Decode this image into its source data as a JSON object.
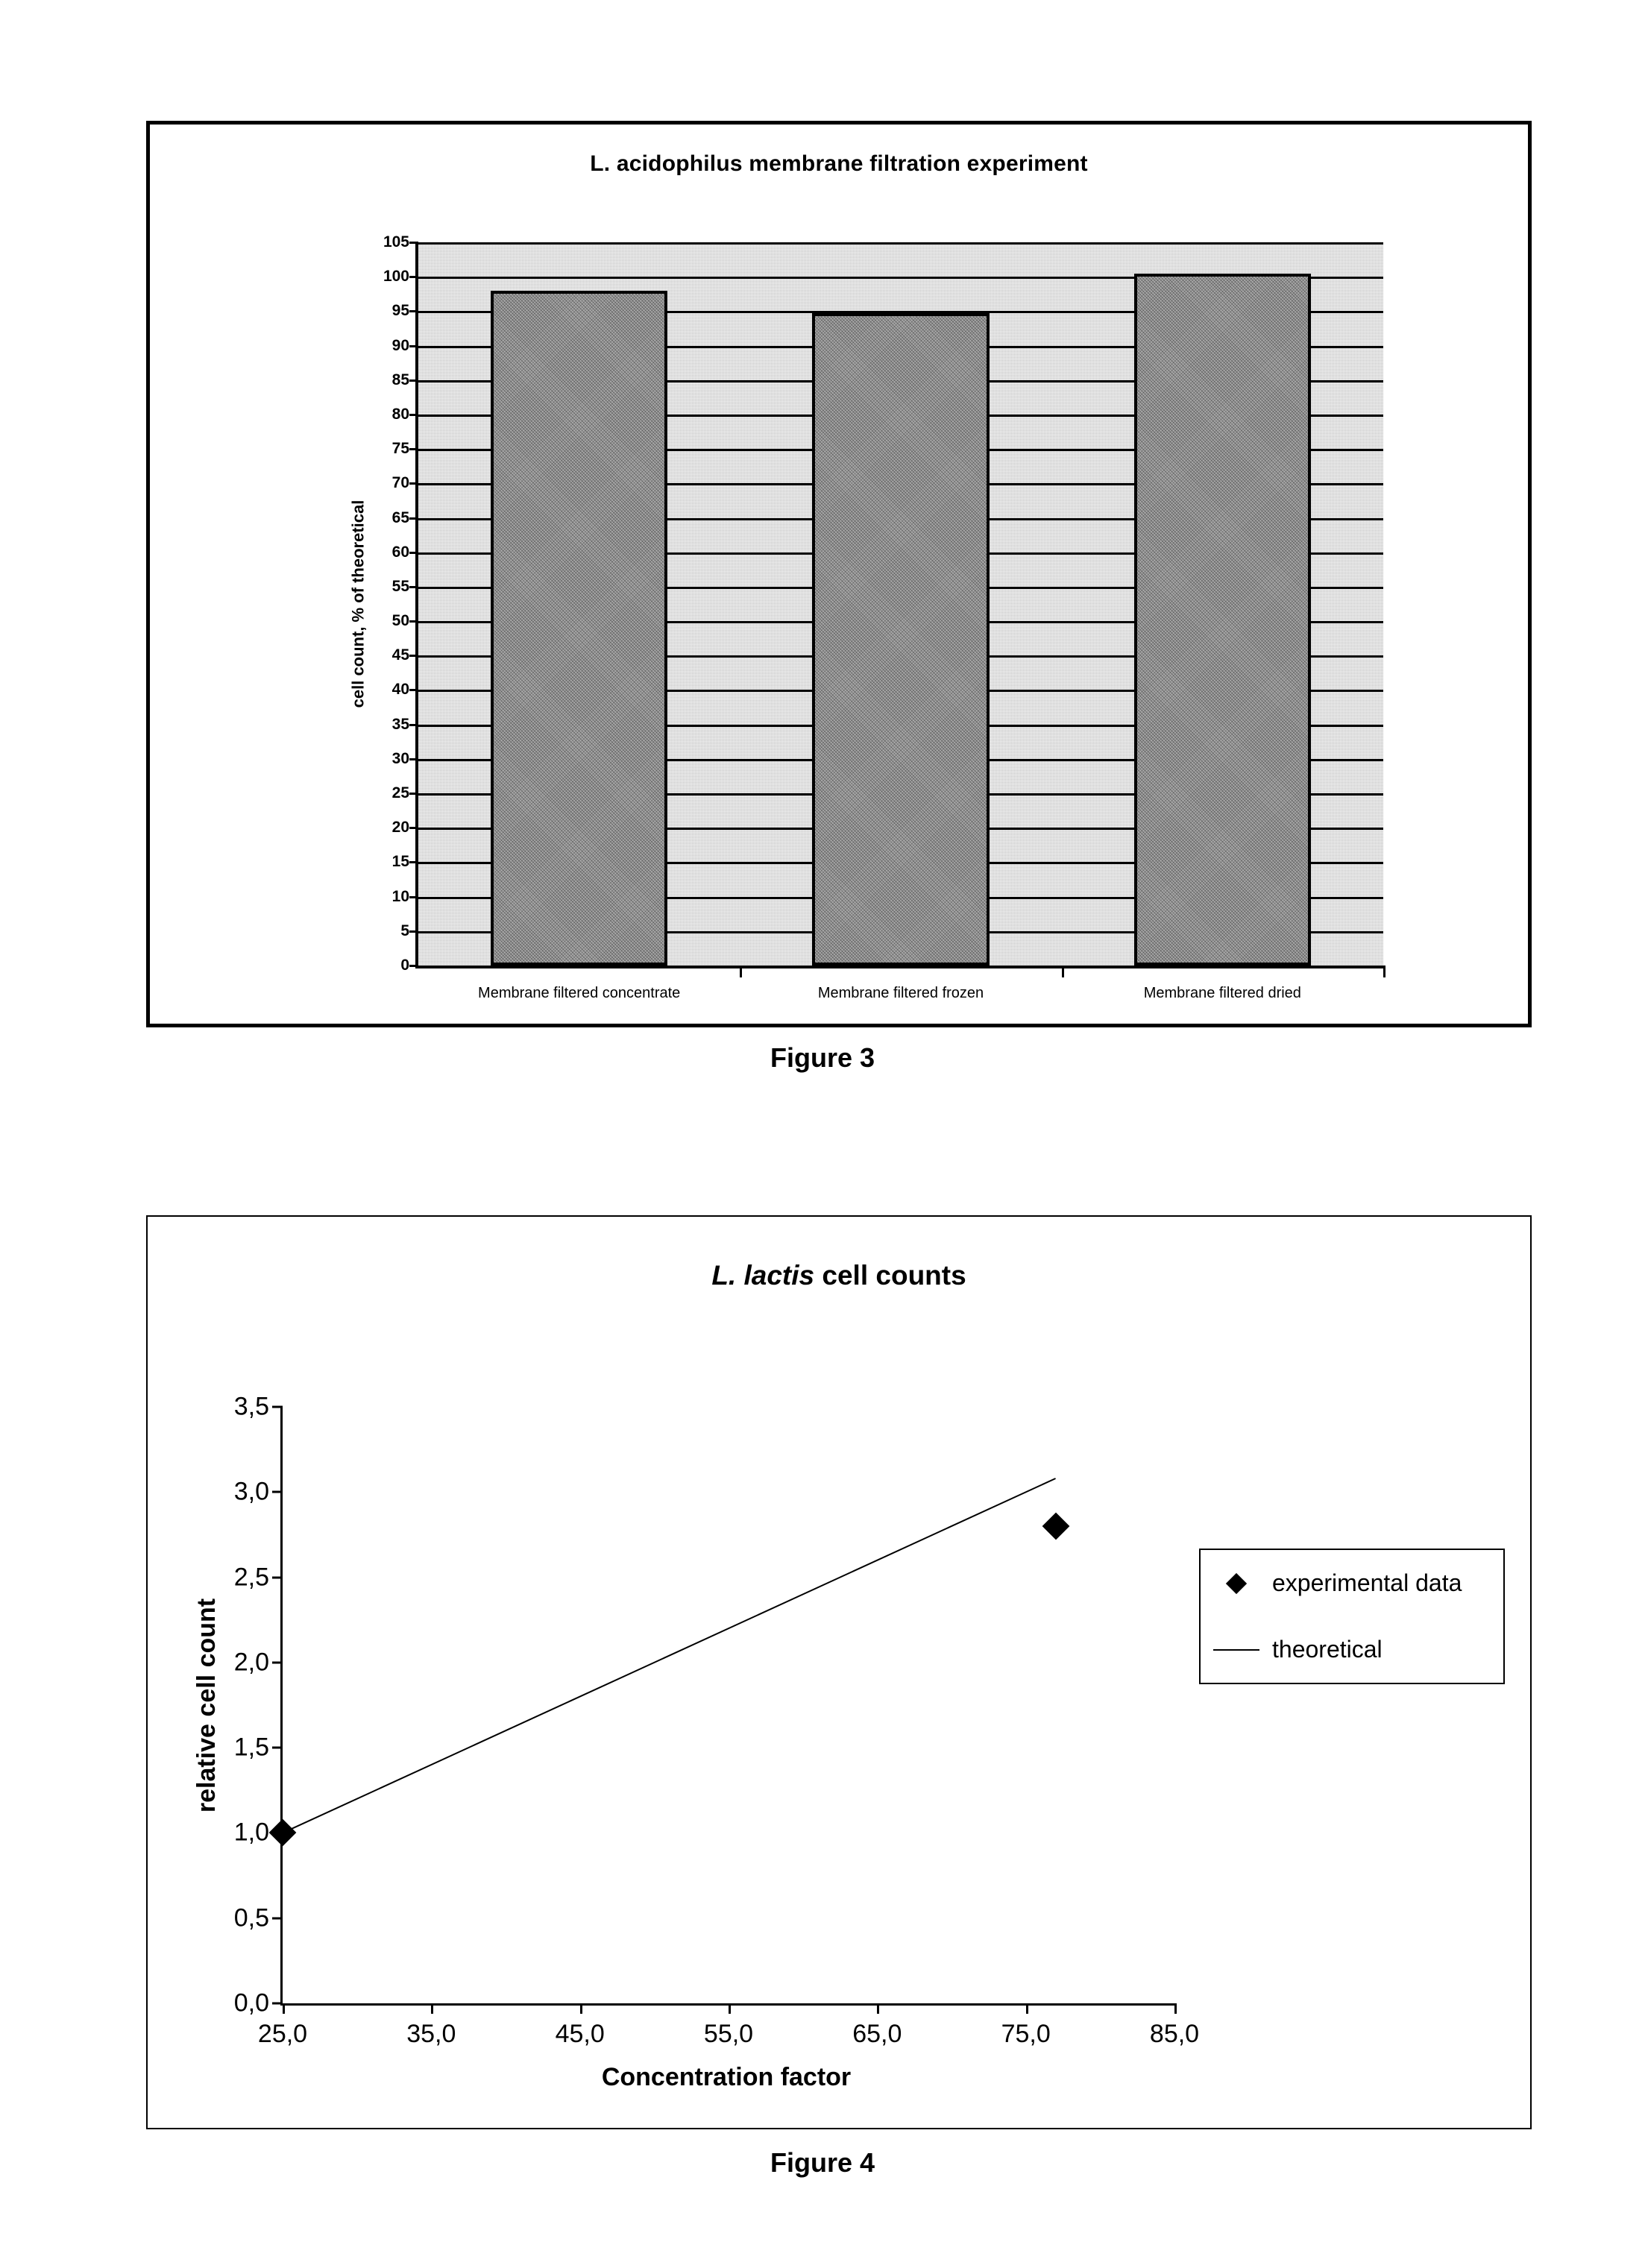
{
  "figures": [
    {
      "caption": "Figure 3",
      "chart_data": {
        "type": "bar",
        "title": "L. acidophilus membrane filtration experiment",
        "xlabel": "",
        "ylabel": "cell count, % of theoretical",
        "categories": [
          "Membrane filtered concentrate",
          "Membrane filtered frozen",
          "Membrane filtered dried"
        ],
        "values": [
          98,
          94.7,
          100.5
        ],
        "ylim": [
          0,
          105
        ],
        "ytick_step": 5,
        "yticks": [
          0,
          5,
          10,
          15,
          20,
          25,
          30,
          35,
          40,
          45,
          50,
          55,
          60,
          65,
          70,
          75,
          80,
          85,
          90,
          95,
          100,
          105
        ],
        "ytick_labels": [
          "0",
          "5",
          "10",
          "15",
          "20",
          "25",
          "30",
          "35",
          "40",
          "45",
          "50",
          "55",
          "60",
          "65",
          "70",
          "75",
          "80",
          "85",
          "90",
          "95",
          "100",
          "105"
        ],
        "grid": true,
        "legend": false,
        "plot_background": "#c8c8c8",
        "bar_fill": "#a8a8a8",
        "bar_edge": "#000000"
      }
    },
    {
      "caption": "Figure 4",
      "chart_data": {
        "type": "scatter",
        "title_species": "L. lactis",
        "title_rest": " cell counts",
        "title": "L. lactis cell counts",
        "xlabel": "Concentration factor",
        "ylabel": "relative cell count",
        "xlim": [
          25.0,
          85.0
        ],
        "ylim": [
          0.0,
          3.5
        ],
        "xticks": [
          25.0,
          35.0,
          45.0,
          55.0,
          65.0,
          75.0,
          85.0
        ],
        "xtick_labels": [
          "25,0",
          "35,0",
          "45,0",
          "55,0",
          "65,0",
          "75,0",
          "85,0"
        ],
        "yticks": [
          0.0,
          0.5,
          1.0,
          1.5,
          2.0,
          2.5,
          3.0,
          3.5
        ],
        "ytick_labels": [
          "0,0",
          "0,5",
          "1,0",
          "1,5",
          "2,0",
          "2,5",
          "3,0",
          "3,5"
        ],
        "grid": false,
        "legend_position": "right",
        "series": [
          {
            "name": "experimental data",
            "marker": "diamond",
            "type": "scatter",
            "x": [
              25.0,
              77.0
            ],
            "y": [
              1.0,
              2.8
            ]
          },
          {
            "name": "theoretical",
            "marker": "line",
            "type": "line",
            "x": [
              25.0,
              77.0
            ],
            "y": [
              1.0,
              3.08
            ]
          }
        ]
      }
    }
  ]
}
